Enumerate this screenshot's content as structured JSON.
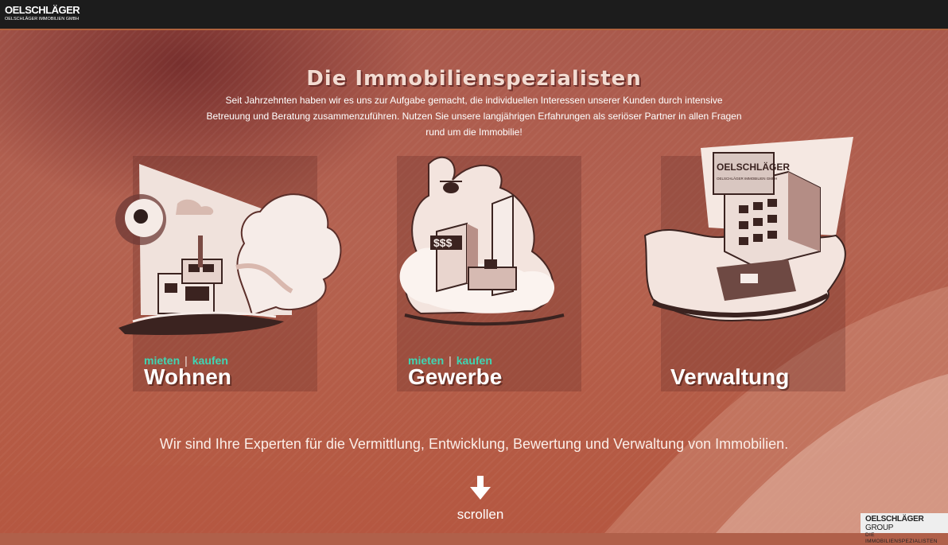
{
  "header": {
    "logo_main": "OELSCHLÄGER",
    "logo_sub": "OELSCHLÄGER IMMOBILIEN GMBH"
  },
  "hero": {
    "headline": "Die Immobilienspezialisten",
    "intro_line1": "Seit Jahrzehnten haben wir es uns zur Aufgabe gemacht, die individuellen Interessen unserer Kunden durch intensive",
    "intro_line2": "Betreuung und Beratung zusammenzuführen. Nutzen Sie unsere langjährigen Erfahrungen als seriöser Partner in allen Fragen",
    "intro_line3": "rund um die Immobilie!"
  },
  "cards": [
    {
      "title": "Wohnen",
      "tag_rent": "mieten",
      "separator": "|",
      "tag_buy": "kaufen"
    },
    {
      "title": "Gewerbe",
      "tag_rent": "mieten",
      "separator": "|",
      "tag_buy": "kaufen",
      "sign_text": "$$$"
    },
    {
      "title": "Verwaltung",
      "building_sign_main": "OELSCHLÄGER",
      "building_sign_sub": "OELSCHLÄGER IMMOBILIEN GMBH"
    }
  ],
  "tagline": "Wir sind Ihre Experten für die Vermittlung, Entwicklung, Bewertung und Verwaltung von Immobilien.",
  "scroll": {
    "label": "scrollen",
    "icon": "arrow-down-icon"
  },
  "footer_logo": {
    "main": "OELSCHLÄGER",
    "group": "GROUP",
    "sub": "DIE IMMOBILIENSPEZIALISTEN"
  },
  "colors": {
    "accent_teal": "#3fd6b3",
    "topbar": "#1c1c1c",
    "background": "#b0604a"
  }
}
